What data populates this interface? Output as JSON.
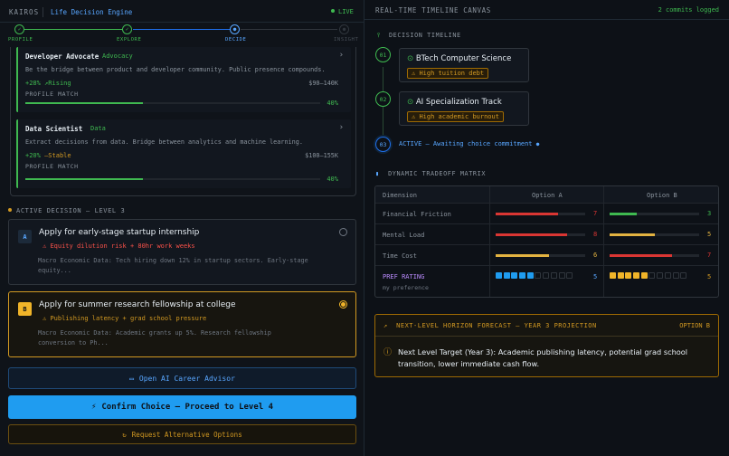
{
  "header": {
    "brand": "KAIROS",
    "engine": "Life Decision Engine",
    "live": "LIVE"
  },
  "stepper": [
    {
      "label": "PROFILE",
      "state": "done"
    },
    {
      "label": "EXPLORE",
      "state": "done"
    },
    {
      "label": "DECIDE",
      "state": "current"
    },
    {
      "label": "INSIGHT",
      "state": "pending"
    }
  ],
  "careers": [
    {
      "title": "Developer Advocate",
      "tag": "Advocacy",
      "desc": "Be the bridge between product and developer community. Public presence compounds.",
      "growth": "+28%",
      "trend": "Rising",
      "salary": "$90–140K",
      "match_label": "PROFILE MATCH",
      "match": 40,
      "match_text": "40%"
    },
    {
      "title": "Data Scientist",
      "tag": "Data",
      "desc": "Extract decisions from data. Bridge between analytics and machine learning.",
      "growth": "+20%",
      "trend": "Stable",
      "salary": "$100–155K",
      "match_label": "PROFILE MATCH",
      "match": 40,
      "match_text": "40%"
    }
  ],
  "active": {
    "heading": "ACTIVE DECISION — LEVEL 3",
    "options": [
      {
        "letter": "A",
        "title": "Apply for early-stage startup internship",
        "risk": "Equity dilution risk + 80hr work weeks",
        "macro": "Macro Economic Data: Tech hiring down 12% in startup sectors. Early-stage equity...",
        "selected": false
      },
      {
        "letter": "B",
        "title": "Apply for summer research fellowship at college",
        "risk": "Publishing latency + grad school pressure",
        "macro": "Macro Economic Data: Academic grants up 5%. Research fellowship conversion to Ph...",
        "selected": true
      }
    ]
  },
  "buttons": {
    "advisor": "Open AI Career Advisor",
    "confirm": "Confirm Choice — Proceed to Level 4",
    "alternatives": "Request Alternative Options"
  },
  "canvas": {
    "title": "REAL-TIME TIMELINE CANVAS",
    "commits": "2 commits logged"
  },
  "timeline": {
    "heading": "DECISION TIMELINE",
    "nodes": [
      {
        "num": "01",
        "title": "BTech Computer Science",
        "warning": "High tuition debt"
      },
      {
        "num": "02",
        "title": "AI Specialization Track",
        "warning": "High academic burnout"
      }
    ],
    "active": {
      "num": "03",
      "text": "ACTIVE — Awaiting choice commitment"
    }
  },
  "matrix": {
    "heading": "DYNAMIC TRADEOFF MATRIX",
    "columns": [
      "Dimension",
      "Option A",
      "Option B"
    ],
    "rows": [
      {
        "label": "Financial Friction",
        "a": 7,
        "b": 3,
        "a_color": "#da3633",
        "b_color": "#3fb950"
      },
      {
        "label": "Mental Load",
        "a": 8,
        "b": 5,
        "a_color": "#da3633",
        "b_color": "#e3b341"
      },
      {
        "label": "Time Cost",
        "a": 6,
        "b": 7,
        "a_color": "#e3b341",
        "b_color": "#da3633"
      }
    ],
    "pref": {
      "label": "PREF RATING",
      "sub": "my preference",
      "a": 5,
      "b": 5,
      "a_color": "#1f9cf0",
      "b_color": "#f0b429"
    }
  },
  "forecast": {
    "heading": "NEXT-LEVEL HORIZON FORECAST — YEAR 3 PROJECTION",
    "option": "OPTION B",
    "text": "Next Level Target (Year 3): Academic publishing latency, potential grad school transition, lower immediate cash flow."
  }
}
